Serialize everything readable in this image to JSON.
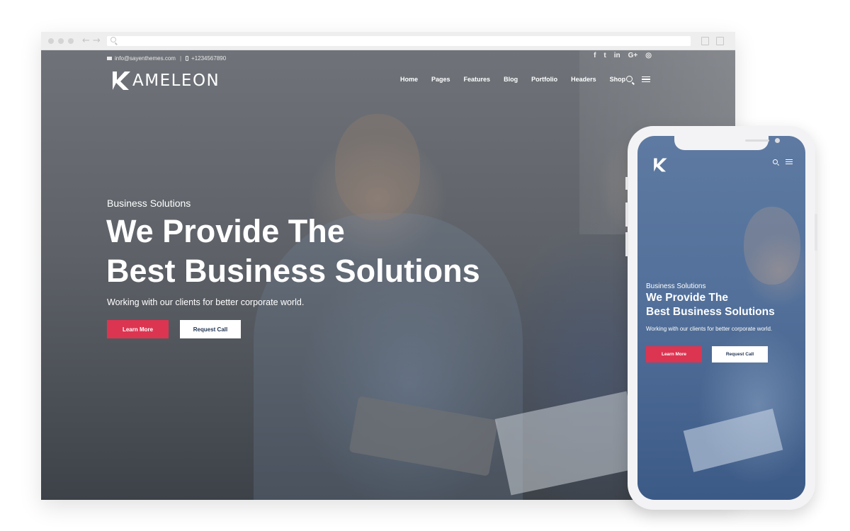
{
  "desktop": {
    "topbar": {
      "email": "info@sayenthemes.com",
      "phone": "+1234567890"
    },
    "social_icons": [
      {
        "name": "facebook-icon",
        "glyph": "f"
      },
      {
        "name": "twitter-icon",
        "glyph": "t"
      },
      {
        "name": "linkedin-icon",
        "glyph": "in"
      },
      {
        "name": "google-plus-icon",
        "glyph": "G+"
      },
      {
        "name": "instagram-icon",
        "glyph": "◎"
      }
    ],
    "logo_text": "AMELEON",
    "menu": [
      "Home",
      "Pages",
      "Features",
      "Blog",
      "Portfolio",
      "Headers",
      "Shop"
    ],
    "hero": {
      "eyebrow": "Business Solutions",
      "headline_line1": "We Provide The",
      "headline_line2": "Best Business Solutions",
      "subtext": "Working with our clients for better corporate world.",
      "primary_button": "Learn More",
      "secondary_button": "Request Call"
    }
  },
  "mobile": {
    "hero": {
      "eyebrow": "Business Solutions",
      "headline_line1": "We Provide The",
      "headline_line2": "Best Business Solutions",
      "subtext": "Working with our clients for better corporate world.",
      "primary_button": "Learn More",
      "secondary_button": "Request Call"
    }
  },
  "colors": {
    "accent": "#dc3551",
    "button_text_dark": "#1f3350",
    "mobile_overlay": "#52709a"
  }
}
